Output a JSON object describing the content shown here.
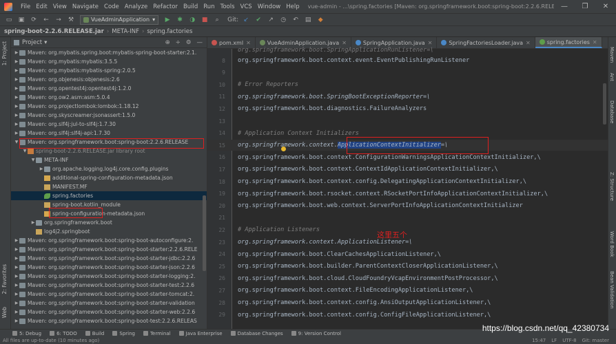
{
  "menu": [
    "File",
    "Edit",
    "View",
    "Navigate",
    "Code",
    "Analyze",
    "Refactor",
    "Build",
    "Run",
    "Tools",
    "VCS",
    "Window",
    "Help"
  ],
  "window_title": "vue-admin - ...\\spring.factories [Maven: org.springframework.boot:spring-boot:2.2.6.RELEASE]",
  "window_buttons": {
    "minimize": "—",
    "maximize": "❐",
    "close": "✕"
  },
  "toolbar": {
    "run_config": "VueAdminApplication",
    "git_label": "Git:"
  },
  "breadcrumb": [
    "spring-boot-2.2.6.RELEASE.jar",
    "META-INF",
    "spring.factories"
  ],
  "project_panel": {
    "title": "Project",
    "left_tabs": [
      "1: Project",
      "2: Favorites",
      "Web"
    ],
    "tree": [
      {
        "label": "Maven: org.mybatis.spring.boot:mybatis-spring-boot-starter:2.1.",
        "indent": 0,
        "icon": "lib",
        "arrow": "▶"
      },
      {
        "label": "Maven: org.mybatis:mybatis:3.5.5",
        "indent": 0,
        "icon": "lib",
        "arrow": "▶"
      },
      {
        "label": "Maven: org.mybatis:mybatis-spring:2.0.5",
        "indent": 0,
        "icon": "lib",
        "arrow": "▶"
      },
      {
        "label": "Maven: org.objenesis:objenesis:2.6",
        "indent": 0,
        "icon": "lib",
        "arrow": "▶"
      },
      {
        "label": "Maven: org.opentest4j:opentest4j:1.2.0",
        "indent": 0,
        "icon": "lib",
        "arrow": "▶"
      },
      {
        "label": "Maven: org.ow2.asm:asm:5.0.4",
        "indent": 0,
        "icon": "lib",
        "arrow": "▶"
      },
      {
        "label": "Maven: org.projectlombok:lombok:1.18.12",
        "indent": 0,
        "icon": "lib",
        "arrow": "▶"
      },
      {
        "label": "Maven: org.skyscreamer:jsonassert:1.5.0",
        "indent": 0,
        "icon": "lib",
        "arrow": "▶"
      },
      {
        "label": "Maven: org.slf4j:jul-to-slf4j:1.7.30",
        "indent": 0,
        "icon": "lib",
        "arrow": "▶"
      },
      {
        "label": "Maven: org.slf4j:slf4j-api:1.7.30",
        "indent": 0,
        "icon": "lib",
        "arrow": "▶"
      },
      {
        "label": "Maven: org.springframework.boot:spring-boot:2.2.6.RELEASE",
        "indent": 0,
        "icon": "lib",
        "arrow": "▼"
      },
      {
        "label": "spring-boot-2.2.6.RELEASE.jar library root",
        "indent": 1,
        "icon": "jar",
        "arrow": "▼",
        "dim": true
      },
      {
        "label": "META-INF",
        "indent": 2,
        "icon": "folder",
        "arrow": "▼"
      },
      {
        "label": "org.apache.logging.log4j.core.config.plugins",
        "indent": 3,
        "icon": "folder",
        "arrow": "▶"
      },
      {
        "label": "additional-spring-configuration-metadata.json",
        "indent": 3,
        "icon": "json",
        "arrow": ""
      },
      {
        "label": "MANIFEST.MF",
        "indent": 3,
        "icon": "file",
        "arrow": ""
      },
      {
        "label": "spring.factories",
        "indent": 3,
        "icon": "leaf",
        "arrow": "",
        "selected": true
      },
      {
        "label": "spring-boot.kotlin_module",
        "indent": 3,
        "icon": "file",
        "arrow": ""
      },
      {
        "label": "spring-configuration-metadata.json",
        "indent": 3,
        "icon": "json",
        "arrow": ""
      },
      {
        "label": "org.springframework.boot",
        "indent": 2,
        "icon": "folder",
        "arrow": "▶"
      },
      {
        "label": "log4j2.springboot",
        "indent": 2,
        "icon": "file",
        "arrow": ""
      },
      {
        "label": "Maven: org.springframework.boot:spring-boot-autoconfigure:2.",
        "indent": 0,
        "icon": "lib",
        "arrow": "▶"
      },
      {
        "label": "Maven: org.springframework.boot:spring-boot-starter:2.2.6.RELE",
        "indent": 0,
        "icon": "lib",
        "arrow": "▶"
      },
      {
        "label": "Maven: org.springframework.boot:spring-boot-starter-jdbc:2.2.6",
        "indent": 0,
        "icon": "lib",
        "arrow": "▶"
      },
      {
        "label": "Maven: org.springframework.boot:spring-boot-starter-json:2.2.6",
        "indent": 0,
        "icon": "lib",
        "arrow": "▶"
      },
      {
        "label": "Maven: org.springframework.boot:spring-boot-starter-logging:2.",
        "indent": 0,
        "icon": "lib",
        "arrow": "▶"
      },
      {
        "label": "Maven: org.springframework.boot:spring-boot-starter-test:2.2.6",
        "indent": 0,
        "icon": "lib",
        "arrow": "▶"
      },
      {
        "label": "Maven: org.springframework.boot:spring-boot-starter-tomcat:2.",
        "indent": 0,
        "icon": "lib",
        "arrow": "▶"
      },
      {
        "label": "Maven: org.springframework.boot:spring-boot-starter-validation",
        "indent": 0,
        "icon": "lib",
        "arrow": "▶"
      },
      {
        "label": "Maven: org.springframework.boot:spring-boot-starter-web:2.2.6",
        "indent": 0,
        "icon": "lib",
        "arrow": "▶"
      },
      {
        "label": "Maven: org.springframework.boot:spring-boot-test:2.2.6.RELEAS",
        "indent": 0,
        "icon": "lib",
        "arrow": "▶"
      }
    ]
  },
  "editor": {
    "tabs": [
      {
        "label": "pom.xml",
        "color": "#c75450",
        "active": false
      },
      {
        "label": "VueAdminApplication.java",
        "color": "#6a8759",
        "active": false
      },
      {
        "label": "SpringApplication.java",
        "color": "#4a88c7",
        "active": false
      },
      {
        "label": "SpringFactoriesLoader.java",
        "color": "#4a88c7",
        "active": false
      },
      {
        "label": "spring.factories",
        "color": "#5e9e4b",
        "active": true
      }
    ],
    "top_partial": "org.springframework.boot.SpringApplicationRunListener=\\",
    "lines": [
      {
        "n": "8",
        "text": "org.springframework.boot.context.event.EventPublishingRunListener",
        "kind": "plain"
      },
      {
        "n": "9",
        "text": "",
        "kind": "plain"
      },
      {
        "n": "10",
        "text": "# Error Reporters",
        "kind": "comment"
      },
      {
        "n": "11",
        "text": "org.springframework.boot.SpringBootExceptionReporter=\\",
        "kind": "key"
      },
      {
        "n": "12",
        "text": "org.springframework.boot.diagnostics.FailureAnalyzers",
        "kind": "plain"
      },
      {
        "n": "13",
        "text": "",
        "kind": "plain"
      },
      {
        "n": "14",
        "text": "# Application Context Initializers",
        "kind": "comment"
      },
      {
        "n": "15",
        "pre": "org.springframework.context.",
        "hl": "ApplicationContextInitializer",
        "post": "=\\",
        "kind": "key-hl"
      },
      {
        "n": "16",
        "text": "org.springframework.boot.context.ConfigurationWarningsApplicationContextInitializer,\\",
        "kind": "plain"
      },
      {
        "n": "17",
        "text": "org.springframework.boot.context.ContextIdApplicationContextInitializer,\\",
        "kind": "plain"
      },
      {
        "n": "18",
        "text": "org.springframework.boot.context.config.DelegatingApplicationContextInitializer,\\",
        "kind": "plain"
      },
      {
        "n": "19",
        "text": "org.springframework.boot.rsocket.context.RSocketPortInfoApplicationContextInitializer,\\",
        "kind": "plain"
      },
      {
        "n": "20",
        "text": "org.springframework.boot.web.context.ServerPortInfoApplicationContextInitializer",
        "kind": "plain"
      },
      {
        "n": "21",
        "text": "",
        "kind": "plain"
      },
      {
        "n": "22",
        "text": "# Application Listeners",
        "kind": "comment"
      },
      {
        "n": "23",
        "text": "org.springframework.context.ApplicationListener=\\",
        "kind": "key"
      },
      {
        "n": "24",
        "text": "org.springframework.boot.ClearCachesApplicationListener,\\",
        "kind": "plain"
      },
      {
        "n": "25",
        "text": "org.springframework.boot.builder.ParentContextCloserApplicationListener,\\",
        "kind": "plain"
      },
      {
        "n": "26",
        "text": "org.springframework.boot.cloud.CloudFoundryVcapEnvironmentPostProcessor,\\",
        "kind": "plain"
      },
      {
        "n": "27",
        "text": "org.springframework.boot.context.FileEncodingApplicationListener,\\",
        "kind": "plain"
      },
      {
        "n": "28",
        "text": "org.springframework.boot.context.config.AnsiOutputApplicationListener,\\",
        "kind": "plain"
      },
      {
        "n": "29",
        "text": "org.springframework.boot.context.config.ConfigFileApplicationListener,\\",
        "kind": "plain"
      }
    ],
    "annotation": "这里五个"
  },
  "right_tabs": [
    "Maven",
    "Ant",
    "Database",
    "Z: Structure",
    "Word Book",
    "Bean Validation"
  ],
  "bottom_tabs": [
    "5: Debug",
    "6: TODO",
    "Build",
    "Spring",
    "Terminal",
    "Java Enterprise",
    "Database Changes",
    "9: Version Control"
  ],
  "status": {
    "message": "All files are up-to-date (10 minutes ago)",
    "position": "15:47",
    "line_sep": "LF",
    "encoding": "UTF-8",
    "git": "Git: master"
  },
  "watermark": "https://blog.csdn.net/qq_42380734"
}
